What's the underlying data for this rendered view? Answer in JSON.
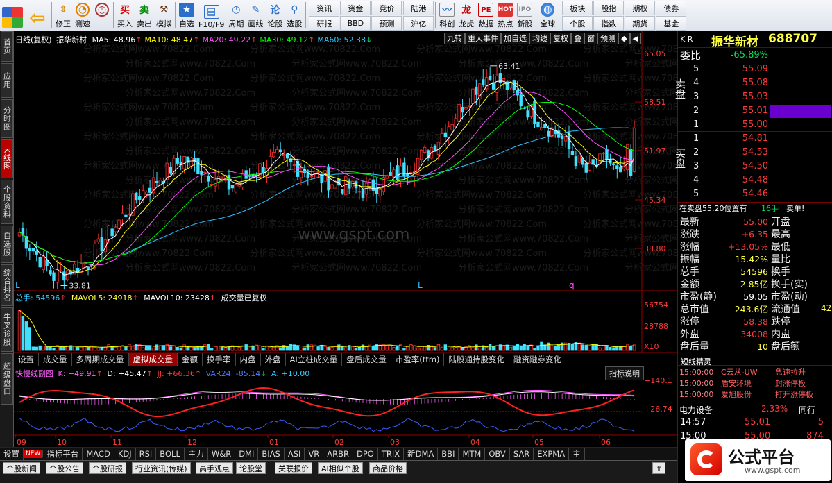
{
  "toolbar": {
    "left_buttons": [
      {
        "label": "",
        "icon": "windows-grid-icon"
      },
      {
        "label": "",
        "icon": "back-arrow-icon"
      },
      {
        "label": "修正",
        "icon": "up-down-icon"
      },
      {
        "label": "测速",
        "icon": "speed-icon"
      },
      {
        "label": "买入",
        "icon": "buy-icon"
      },
      {
        "label": "卖出",
        "icon": "sell-icon"
      },
      {
        "label": "模拟",
        "icon": "hammer-icon"
      },
      {
        "label": "自选",
        "icon": "star-icon"
      },
      {
        "label": "F10/F9",
        "icon": "f10-icon"
      },
      {
        "label": "周期",
        "icon": "clock-icon"
      },
      {
        "label": "画线",
        "icon": "pencil-icon"
      },
      {
        "label": "论股",
        "icon": "chat-icon"
      },
      {
        "label": "选股",
        "icon": "magnifier-icon"
      }
    ],
    "grid1": [
      "资讯",
      "资金",
      "竞价",
      "研报",
      "BBD",
      "预测",
      "陆港",
      "沪亿"
    ],
    "icons2": [
      {
        "label": "科创",
        "icon": "chart-icon"
      },
      {
        "label": "龙虎",
        "icon": "dragon-icon"
      },
      {
        "label": "数据",
        "icon": "pe-icon"
      },
      {
        "label": "热点",
        "icon": "hot-icon"
      },
      {
        "label": "新股",
        "icon": "ipo-icon"
      },
      {
        "label": "全球",
        "icon": "globe-icon"
      }
    ],
    "grid2": [
      "板块",
      "股指",
      "期权",
      "债券",
      "个股",
      "指数",
      "期货",
      "基金"
    ]
  },
  "sidetabs": [
    {
      "label": "首页",
      "active": false
    },
    {
      "label": "应用",
      "active": false
    },
    {
      "label": "分时图",
      "active": false
    },
    {
      "label": "K线图",
      "active": true
    },
    {
      "label": "个股资料",
      "active": false
    },
    {
      "label": "自选股",
      "active": false
    },
    {
      "label": "综合排名",
      "active": false
    },
    {
      "label": "牛叉诊股",
      "active": false
    },
    {
      "label": "超级盘口",
      "active": false
    }
  ],
  "kline": {
    "title": "日线(复权)",
    "name": "振华新材",
    "ma": [
      {
        "label": "MA5: 48.96",
        "color": "#ffffff"
      },
      {
        "label": "MA10: 48.47",
        "color": "#ffff00"
      },
      {
        "label": "MA20: 49.22",
        "color": "#ff50ff"
      },
      {
        "label": "MA30: 49.12",
        "color": "#00ff00"
      },
      {
        "label": "MA60: 52.38",
        "color": "#30c0ff"
      }
    ],
    "tools": [
      "九转",
      "重大事件",
      "加自选",
      "均线",
      "复权",
      "叠",
      "窗",
      "预测",
      "◆",
      "◀"
    ],
    "price_ticks": [
      "65.05",
      "58.51",
      "51.97",
      "45.34",
      "38.80"
    ],
    "high_label": "63.41",
    "low_label": "33.81",
    "watermark": "分析家公式网www.70822.Com",
    "center_mark": "www.gspt.com",
    "markers": [
      "L",
      "L",
      "q"
    ]
  },
  "volume": {
    "total": "总手: 54596",
    "mavol5": "MAVOL5: 24918",
    "mavol10": "MAVOL10: 23428",
    "note": "成交量已复权",
    "ticks": [
      "56754",
      "28788",
      "X10"
    ]
  },
  "tabs1": [
    {
      "label": "设置",
      "active": false
    },
    {
      "label": "成交量",
      "active": false
    },
    {
      "label": "多周期成交量",
      "active": false
    },
    {
      "label": "虚拟成交量",
      "active": true
    },
    {
      "label": "金额",
      "active": false
    },
    {
      "label": "换手率",
      "active": false
    },
    {
      "label": "内盘",
      "active": false
    },
    {
      "label": "外盘",
      "active": false
    },
    {
      "label": "AI立桩成交量",
      "active": false
    },
    {
      "label": "盘后成交量",
      "active": false
    },
    {
      "label": "市盈率(ttm)",
      "active": false
    },
    {
      "label": "陆股通持股变化",
      "active": false
    },
    {
      "label": "融资融券变化",
      "active": false
    }
  ],
  "indicator": {
    "name": "快慢线副图",
    "k": "K: +49.91",
    "d": "D: +45.47",
    "jj": "JJ: +66.36",
    "var24": "VAR24: -85.14",
    "a": "A: +10.00",
    "help": "指标说明",
    "ticks": [
      "+140.1",
      "+26.74"
    ],
    "months": [
      "09",
      "10",
      "11",
      "12",
      "01",
      "02",
      "03",
      "04",
      "05",
      "06"
    ]
  },
  "tabs2": [
    "设置",
    "NEW",
    "指标平台",
    "MACD",
    "KDJ",
    "RSI",
    "BOLL",
    "主力",
    "W&R",
    "DMI",
    "BIAS",
    "ASI",
    "VR",
    "ARBR",
    "DPO",
    "TRIX",
    "新DMA",
    "BBI",
    "MTM",
    "OBV",
    "SAR",
    "EXPMA",
    "主"
  ],
  "bottom": [
    "个股新闻",
    "个股公告",
    "个股研报",
    "行业资讯(传媒)",
    "高手观点",
    "论股堂",
    "关联报价",
    "AI相似个股",
    "商品价格"
  ],
  "quote": {
    "market": "K R",
    "name": "振华新材",
    "code": "688707",
    "weibi_label": "委比",
    "weibi": "-65.89%",
    "sell": [
      {
        "n": "5",
        "p": "55.09"
      },
      {
        "n": "4",
        "p": "55.08"
      },
      {
        "n": "3",
        "p": "55.03"
      },
      {
        "n": "2",
        "p": "55.01"
      },
      {
        "n": "1",
        "p": "55.00"
      }
    ],
    "buy": [
      {
        "n": "1",
        "p": "54.81"
      },
      {
        "n": "2",
        "p": "54.53"
      },
      {
        "n": "3",
        "p": "54.50"
      },
      {
        "n": "4",
        "p": "54.48"
      },
      {
        "n": "5",
        "p": "54.46"
      }
    ],
    "sell_label": "卖盘",
    "buy_label": "买盘",
    "notice": "在卖盘55.20位置有",
    "notice_qty": "16手",
    "notice_act": "卖单!",
    "stats": [
      {
        "l": "最新",
        "v": "55.00",
        "c": "red",
        "r": "开盘"
      },
      {
        "l": "涨跌",
        "v": "+6.35",
        "c": "red",
        "r": "最高"
      },
      {
        "l": "涨幅",
        "v": "+13.05%",
        "c": "red",
        "r": "最低"
      },
      {
        "l": "振幅",
        "v": "15.42%",
        "c": "yel",
        "r": "量比"
      },
      {
        "l": "总手",
        "v": "54596",
        "c": "yel",
        "r": "换手"
      },
      {
        "l": "金额",
        "v": "2.85亿",
        "c": "yel",
        "r": "换手(实)"
      },
      {
        "l": "市盈(静)",
        "v": "59.05",
        "c": "wht",
        "r": "市盈(动)"
      },
      {
        "l": "总市值",
        "v": "243.6亿",
        "c": "yel",
        "r": "流通值"
      },
      {
        "l": "涨停",
        "v": "58.38",
        "c": "red",
        "r": "跌停"
      },
      {
        "l": "外盘",
        "v": "34008",
        "c": "red",
        "r": "内盘"
      },
      {
        "l": "盘后量",
        "v": "10",
        "c": "yel",
        "r": "盘后额"
      }
    ],
    "flow_extra": "42",
    "news_title": "短线精灵",
    "news": [
      {
        "t": "15:00:00",
        "n": "C云从-UW",
        "e": "急速拉升"
      },
      {
        "t": "15:00:00",
        "n": "盾安环境",
        "e": "封涨停板"
      },
      {
        "t": "15:00:00",
        "n": "爱旭股份",
        "e": "打开涨停板"
      }
    ],
    "industry": "电力设备",
    "industry_pct": "2.33%",
    "industry_tag": "同行",
    "ticks": [
      {
        "t": "14:57",
        "p": "55.01",
        "v": "5"
      },
      {
        "t": "15:00",
        "p": "55.00",
        "v": "874"
      }
    ],
    "logo_text": "公式平台",
    "logo_url": "www.gspt.com"
  }
}
